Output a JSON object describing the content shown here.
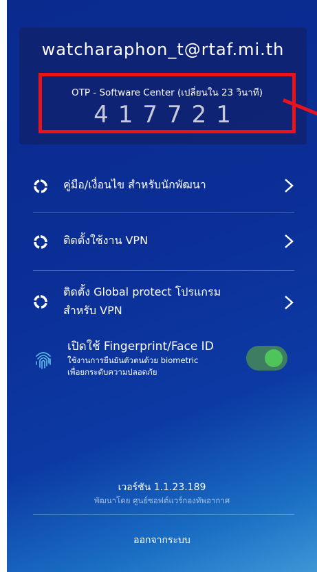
{
  "account": {
    "email": "watcharaphon_t@rtaf.mi.th",
    "otp_label": "OTP - Software Center (เปลี่ยนใน 23 วินาที)",
    "otp_code": "417721"
  },
  "menu": {
    "items": [
      {
        "label": "คู่มือ/เงื่อนไข สำหรับนักพัฒนา",
        "icon": "spinner-icon"
      },
      {
        "label": "ติดตั้งใช้งาน VPN",
        "icon": "spinner-icon"
      },
      {
        "label_line1": "ติดตั้ง Global protect โปรแกรม",
        "label_line2": "สำหรับ VPN",
        "icon": "spinner-icon"
      }
    ]
  },
  "fingerprint": {
    "title": "เปิดใช้ Fingerprint/Face ID",
    "desc_line1": "ใช้งานการยืนยันตัวตนด้วย biometric",
    "desc_line2": "เพื่อยกระดับความปลอดภัย",
    "enabled": true,
    "icon": "fingerprint-icon"
  },
  "footer": {
    "version": "เวอร์ชัน 1.1.23.189",
    "developer": "พัฒนาโดย ศูนย์ซอฟต์แวร์กองทัพอากาศ",
    "logout": "ออกจากระบบ"
  },
  "colors": {
    "background": "#0b2f97",
    "card": "#10226e",
    "highlight": "#e8141c",
    "toggle_on": "#4ec45a"
  }
}
